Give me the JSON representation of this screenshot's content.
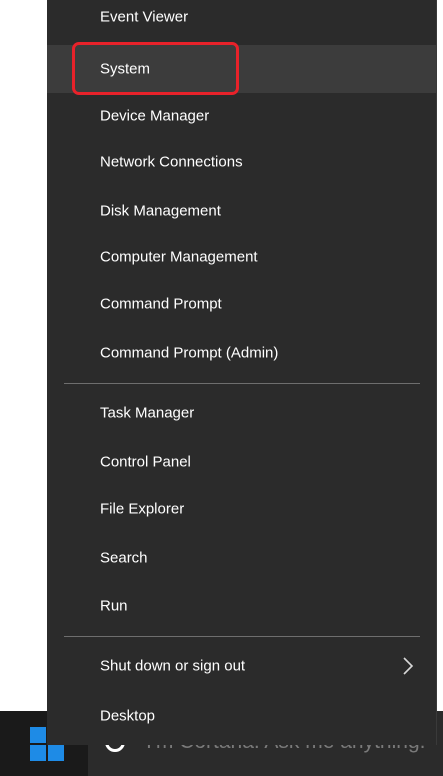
{
  "menu": {
    "items": [
      {
        "label": "Event Viewer"
      },
      {
        "label": "System"
      },
      {
        "label": "Device Manager"
      },
      {
        "label": "Network Connections"
      },
      {
        "label": "Disk Management"
      },
      {
        "label": "Computer Management"
      },
      {
        "label": "Command Prompt"
      },
      {
        "label": "Command Prompt (Admin)"
      },
      {
        "label": "Task Manager"
      },
      {
        "label": "Control Panel"
      },
      {
        "label": "File Explorer"
      },
      {
        "label": "Search"
      },
      {
        "label": "Run"
      },
      {
        "label": "Shut down or sign out"
      },
      {
        "label": "Desktop"
      }
    ]
  },
  "taskbar": {
    "cortana_placeholder": "I'm Cortana. Ask me anything."
  },
  "colors": {
    "menu_background": "#2b2b2b",
    "hover_background": "#3c3c3c",
    "highlight_outline": "#e8222a",
    "windows_logo": "#1e8be6"
  },
  "icons": {
    "submenu_arrow": "chevron-right-icon",
    "start": "windows-logo-icon",
    "cortana": "cortana-circle-icon"
  }
}
